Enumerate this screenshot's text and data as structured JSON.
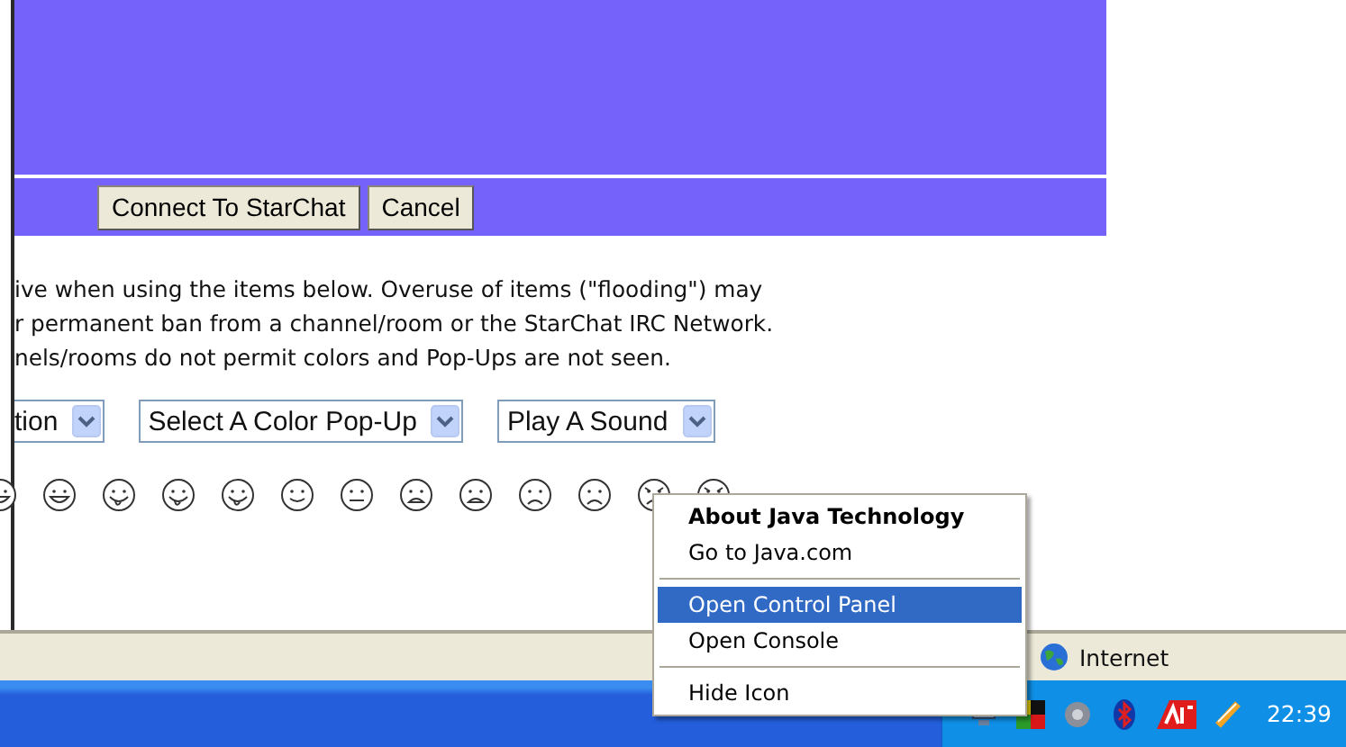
{
  "dialog_buttons": [
    {
      "label": "Connect To StarChat"
    },
    {
      "label": "Cancel"
    }
  ],
  "notice_lines": [
    "ive when using the items below. Overuse of items (\"flooding\") may",
    "r permanent ban from a channel/room or the StarChat IRC Network.",
    "nels/rooms do not permit colors and Pop-Ups are not seen."
  ],
  "dropdowns": [
    {
      "value": "tion"
    },
    {
      "value": "Select A Color Pop-Up"
    },
    {
      "value": "Play A Sound"
    }
  ],
  "smileys": [
    {
      "kind": "grin"
    },
    {
      "kind": "grin"
    },
    {
      "kind": "tongue"
    },
    {
      "kind": "tongue"
    },
    {
      "kind": "tongue"
    },
    {
      "kind": "smile"
    },
    {
      "kind": "neutral"
    },
    {
      "kind": "open"
    },
    {
      "kind": "open"
    },
    {
      "kind": "frown"
    },
    {
      "kind": "frown"
    },
    {
      "kind": "angry"
    },
    {
      "kind": "angry"
    }
  ],
  "status_bar": {
    "zone": "Internet"
  },
  "context_menu": {
    "items": [
      {
        "label": "About Java Technology",
        "kind": "default",
        "selected": false
      },
      {
        "label": "Go to Java.com",
        "kind": "item",
        "selected": false
      },
      {
        "kind": "separator"
      },
      {
        "label": "Open Control Panel",
        "kind": "item",
        "selected": true
      },
      {
        "label": "Open Console",
        "kind": "item",
        "selected": false
      },
      {
        "kind": "separator"
      },
      {
        "label": "Hide Icon",
        "kind": "item",
        "selected": false
      }
    ]
  },
  "taskbar": {
    "clock": "22:39"
  }
}
